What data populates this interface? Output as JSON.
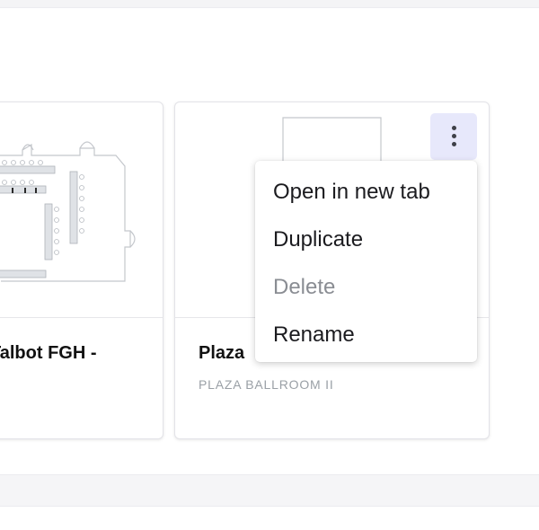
{
  "cards": [
    {
      "title": "Talbot FGH -",
      "subtitle": ""
    },
    {
      "title": "Plaza",
      "subtitle": "PLAZA BALLROOM II"
    }
  ],
  "menu": {
    "items": [
      {
        "label": "Open in new tab",
        "disabled": false
      },
      {
        "label": "Duplicate",
        "disabled": false
      },
      {
        "label": "Delete",
        "disabled": true
      },
      {
        "label": "Rename",
        "disabled": false
      }
    ]
  },
  "icons": {
    "menu_trigger": "more-vertical-icon"
  },
  "colors": {
    "accent_bg": "#e7e8fb",
    "disabled_text": "#8a8d93",
    "subtitle_text": "#9aa0a6"
  }
}
